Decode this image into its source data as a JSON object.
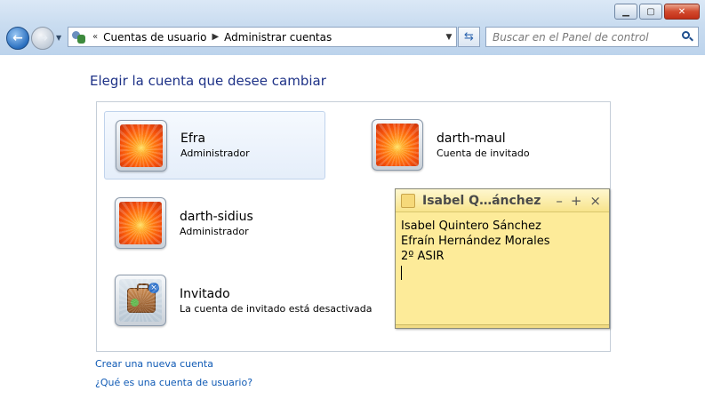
{
  "window": {
    "minimize_icon": "minimize-icon",
    "maximize_icon": "maximize-icon",
    "close_icon": "close-icon"
  },
  "navigation": {
    "address": {
      "overflow": "«",
      "crumbs": [
        "Cuentas de usuario",
        "Administrar cuentas"
      ]
    },
    "search": {
      "placeholder": "Buscar en el Panel de control"
    }
  },
  "main": {
    "heading": "Elegir la cuenta que desee cambiar",
    "accounts": [
      {
        "name": "Efra",
        "type": "Administrador",
        "picture": "flower"
      },
      {
        "name": "darth-maul",
        "type": "Cuenta de invitado",
        "picture": "flower"
      },
      {
        "name": "darth-sidius",
        "type": "Administrador",
        "picture": "flower"
      },
      {
        "name": "Invitado",
        "type": "La cuenta de invitado está desactivada",
        "picture": "guest-briefcase"
      }
    ],
    "links": [
      "Crear una nueva cuenta",
      "¿Qué es una cuenta de usuario?"
    ]
  },
  "sticky_note": {
    "title": "Isabel Q…ánchez",
    "lines": [
      "Isabel Quintero Sánchez",
      "Efraín Hernández Morales",
      "2º ASIR"
    ],
    "controls": [
      "–",
      "+",
      "×"
    ],
    "background_color": "#fdeb99"
  }
}
